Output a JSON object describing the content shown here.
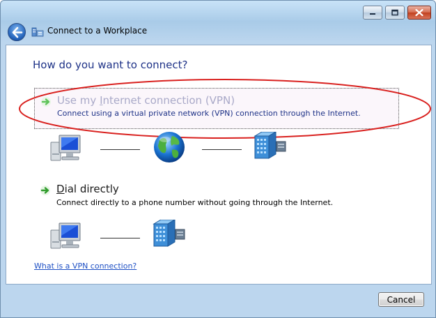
{
  "window": {
    "title": "Connect to a Workplace",
    "controls": {
      "minimize": "minimize-icon",
      "maximize": "maximize-icon",
      "close": "close-icon"
    }
  },
  "main": {
    "heading": "How do you want to connect?",
    "options": [
      {
        "title_prefix": "Use my ",
        "title_access": "I",
        "title_suffix": "nternet connection (VPN)",
        "description": "Connect using a virtual private network (VPN) connection through the Internet.",
        "icons": [
          "computer-icon",
          "globe-icon",
          "corporate-network-icon"
        ]
      },
      {
        "title_prefix": "",
        "title_access": "D",
        "title_suffix": "ial directly",
        "description": "Connect directly to a phone number without going through the Internet.",
        "icons": [
          "computer-icon",
          "corporate-network-icon"
        ]
      }
    ],
    "help_link": "What is a VPN connection?"
  },
  "footer": {
    "cancel_label": "Cancel"
  },
  "colors": {
    "heading": "#1e3287",
    "link": "#1d4fc4",
    "highlight_oval": "#d9201e"
  }
}
